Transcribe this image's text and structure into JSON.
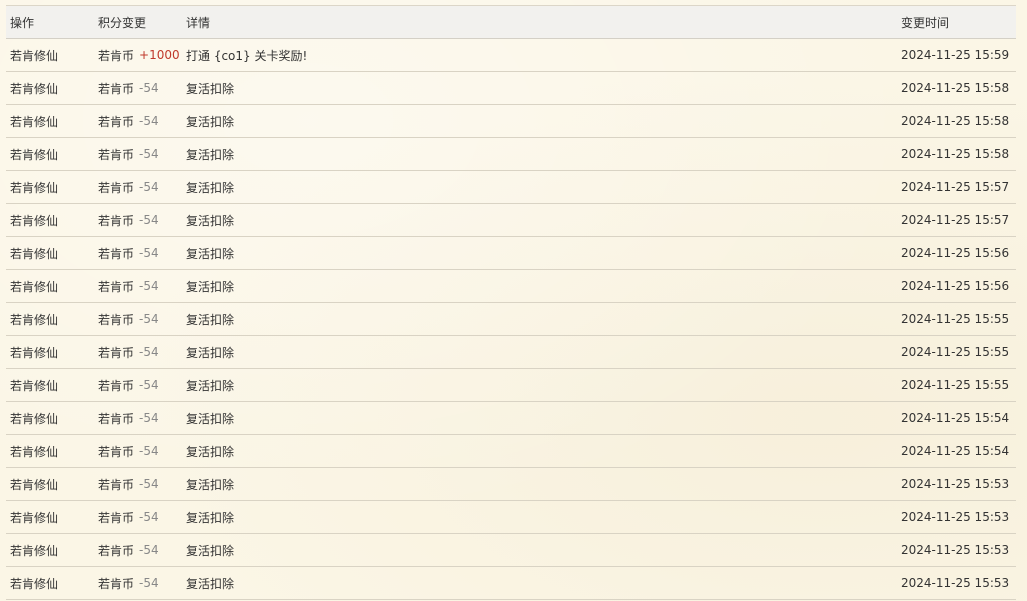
{
  "table": {
    "headers": {
      "op": "操作",
      "change": "积分变更",
      "detail": "详情",
      "time": "变更时间"
    },
    "rows": [
      {
        "op": "若肯修仙",
        "currency": "若肯币",
        "amount": "+1000",
        "positive": true,
        "detail": "打通 {co1} 关卡奖励!",
        "time": "2024-11-25 15:59"
      },
      {
        "op": "若肯修仙",
        "currency": "若肯币",
        "amount": "-54",
        "positive": false,
        "detail": "复活扣除",
        "time": "2024-11-25 15:58"
      },
      {
        "op": "若肯修仙",
        "currency": "若肯币",
        "amount": "-54",
        "positive": false,
        "detail": "复活扣除",
        "time": "2024-11-25 15:58"
      },
      {
        "op": "若肯修仙",
        "currency": "若肯币",
        "amount": "-54",
        "positive": false,
        "detail": "复活扣除",
        "time": "2024-11-25 15:58"
      },
      {
        "op": "若肯修仙",
        "currency": "若肯币",
        "amount": "-54",
        "positive": false,
        "detail": "复活扣除",
        "time": "2024-11-25 15:57"
      },
      {
        "op": "若肯修仙",
        "currency": "若肯币",
        "amount": "-54",
        "positive": false,
        "detail": "复活扣除",
        "time": "2024-11-25 15:57"
      },
      {
        "op": "若肯修仙",
        "currency": "若肯币",
        "amount": "-54",
        "positive": false,
        "detail": "复活扣除",
        "time": "2024-11-25 15:56"
      },
      {
        "op": "若肯修仙",
        "currency": "若肯币",
        "amount": "-54",
        "positive": false,
        "detail": "复活扣除",
        "time": "2024-11-25 15:56"
      },
      {
        "op": "若肯修仙",
        "currency": "若肯币",
        "amount": "-54",
        "positive": false,
        "detail": "复活扣除",
        "time": "2024-11-25 15:55"
      },
      {
        "op": "若肯修仙",
        "currency": "若肯币",
        "amount": "-54",
        "positive": false,
        "detail": "复活扣除",
        "time": "2024-11-25 15:55"
      },
      {
        "op": "若肯修仙",
        "currency": "若肯币",
        "amount": "-54",
        "positive": false,
        "detail": "复活扣除",
        "time": "2024-11-25 15:55"
      },
      {
        "op": "若肯修仙",
        "currency": "若肯币",
        "amount": "-54",
        "positive": false,
        "detail": "复活扣除",
        "time": "2024-11-25 15:54"
      },
      {
        "op": "若肯修仙",
        "currency": "若肯币",
        "amount": "-54",
        "positive": false,
        "detail": "复活扣除",
        "time": "2024-11-25 15:54"
      },
      {
        "op": "若肯修仙",
        "currency": "若肯币",
        "amount": "-54",
        "positive": false,
        "detail": "复活扣除",
        "time": "2024-11-25 15:53"
      },
      {
        "op": "若肯修仙",
        "currency": "若肯币",
        "amount": "-54",
        "positive": false,
        "detail": "复活扣除",
        "time": "2024-11-25 15:53"
      },
      {
        "op": "若肯修仙",
        "currency": "若肯币",
        "amount": "-54",
        "positive": false,
        "detail": "复活扣除",
        "time": "2024-11-25 15:53"
      },
      {
        "op": "若肯修仙",
        "currency": "若肯币",
        "amount": "-54",
        "positive": false,
        "detail": "复活扣除",
        "time": "2024-11-25 15:53"
      }
    ]
  },
  "colors": {
    "positive_amount": "#c0392b",
    "negative_amount": "#888888",
    "background": "#fbf6e6",
    "header_background": "#f2f1ee"
  }
}
